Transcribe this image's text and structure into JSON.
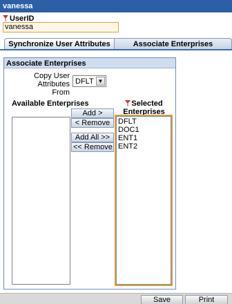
{
  "window": {
    "title": "vanessa"
  },
  "user": {
    "label": "UserID",
    "value": "vanessa"
  },
  "tabs": [
    {
      "label": "Synchronize User Attributes"
    },
    {
      "label": "Associate Enterprises"
    }
  ],
  "panel": {
    "title": "Associate Enterprises",
    "copy_label": "Copy User Attributes From",
    "copy_value": "DFLT",
    "available_label": "Available Enterprises",
    "selected_label": "Selected Enterprises",
    "available": [],
    "selected": [
      "DFLT",
      "DOC1",
      "ENT1",
      "ENT2"
    ],
    "buttons": {
      "add": "Add >",
      "remove": "< Remove",
      "add_all": "Add All >>",
      "remove_all": "<< Remove All"
    }
  },
  "footer": {
    "save": "Save",
    "print": "Print"
  },
  "colors": {
    "titlebar": "#2c5fa5",
    "required_flag": "#c0392b",
    "accent_border": "#d4a050"
  },
  "icons": {
    "required": "required-flag-icon",
    "dropdown": "chevron-down-icon"
  }
}
